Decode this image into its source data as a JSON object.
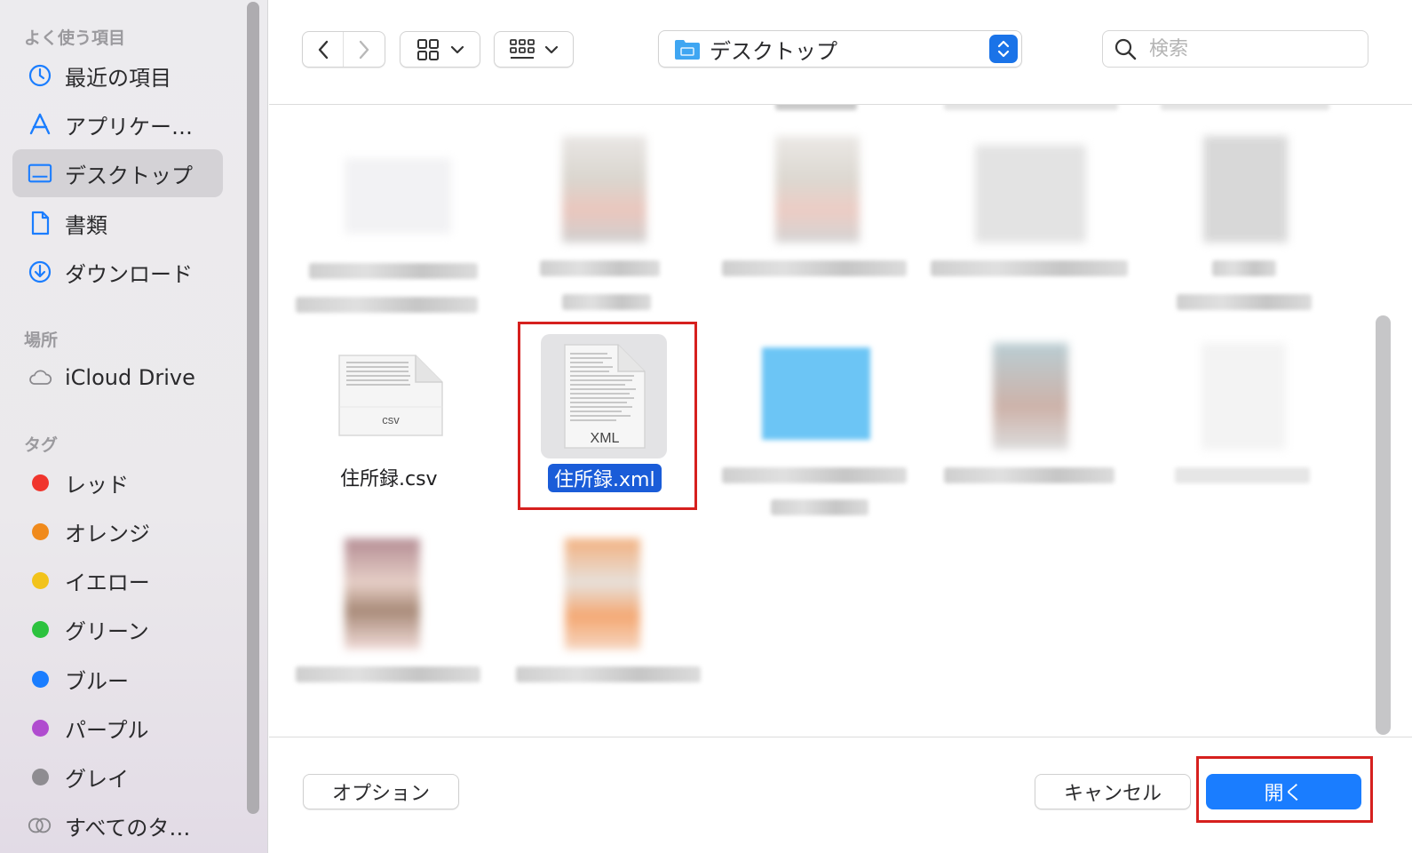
{
  "sidebar": {
    "sections": {
      "favorites": "よく使う項目",
      "locations": "場所",
      "tags": "タグ"
    },
    "favorites": [
      {
        "label": "最近の項目",
        "icon": "clock-icon"
      },
      {
        "label": "アプリケー…",
        "icon": "applications-icon"
      },
      {
        "label": "デスクトップ",
        "icon": "desktop-icon",
        "active": true
      },
      {
        "label": "書類",
        "icon": "document-icon"
      },
      {
        "label": "ダウンロード",
        "icon": "download-icon"
      }
    ],
    "locations": [
      {
        "label": "iCloud Drive",
        "icon": "cloud-icon"
      }
    ],
    "tags": [
      {
        "label": "レッド",
        "color": "#f0352d"
      },
      {
        "label": "オレンジ",
        "color": "#f08a1c"
      },
      {
        "label": "イエロー",
        "color": "#f2c31b"
      },
      {
        "label": "グリーン",
        "color": "#2cc23e"
      },
      {
        "label": "ブルー",
        "color": "#1a7dff"
      },
      {
        "label": "パープル",
        "color": "#b04ccf"
      },
      {
        "label": "グレイ",
        "color": "#8e8c91"
      },
      {
        "label": "すべてのタ…",
        "icon": "all-tags-icon"
      }
    ]
  },
  "toolbar": {
    "path_label": "デスクトップ",
    "search_placeholder": "検索"
  },
  "files": {
    "csv": {
      "name": "住所録.csv",
      "icon_text": "csv"
    },
    "xml": {
      "name": "住所録.xml",
      "icon_text": "XML",
      "selected": true
    }
  },
  "buttons": {
    "options": "オプション",
    "cancel": "キャンセル",
    "open": "開く"
  },
  "colors": {
    "accent": "#1a7dff",
    "selection": "#1a5cd8",
    "highlight_box": "#d6201e"
  }
}
